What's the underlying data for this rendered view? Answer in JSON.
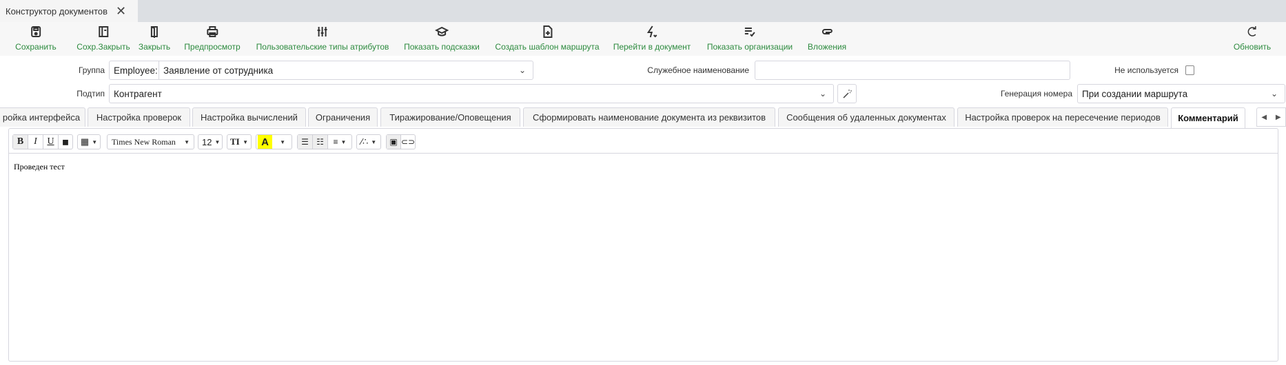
{
  "window_tab": {
    "title": "Конструктор документов",
    "close": "✕"
  },
  "toolbar": {
    "save": "Сохранить",
    "save_close": "Сохр.Закрыть",
    "close": "Закрыть",
    "preview": "Предпросмотр",
    "custom_types": "Пользовательские типы атрибутов",
    "show_hints": "Показать подсказки",
    "create_route_template": "Создать шаблон маршрута",
    "go_to_document": "Перейти в документ",
    "show_orgs": "Показать организации",
    "attachments": "Вложения",
    "refresh": "Обновить"
  },
  "form": {
    "group_label": "Группа",
    "group_code": "Employee:",
    "group_value": "Заявление от сотрудника",
    "service_name_label": "Служебное наименование",
    "service_name_value": "",
    "not_used_label": "Не используется",
    "not_used_checked": false,
    "subtype_label": "Подтип",
    "subtype_value": "Контрагент",
    "numbering_label": "Генерация номера",
    "numbering_value": "При создании маршрута"
  },
  "tabs": [
    "ройка интерфейса",
    "Настройка проверок",
    "Настройка вычислений",
    "Ограничения",
    "Тиражирование/Оповещения",
    "Сформировать наименование документа из реквизитов",
    "Сообщения об удаленных документах",
    "Настройка проверок на пересечение периодов",
    "Комментарий"
  ],
  "active_tab": "Комментарий",
  "editor": {
    "bold": "B",
    "italic": "I",
    "underline": "U",
    "font_name": "Times New Roman",
    "font_size": "12",
    "text_style": "TI",
    "font_color": "A",
    "highlight_color": "#ffff00",
    "content": "Проведен тест"
  }
}
